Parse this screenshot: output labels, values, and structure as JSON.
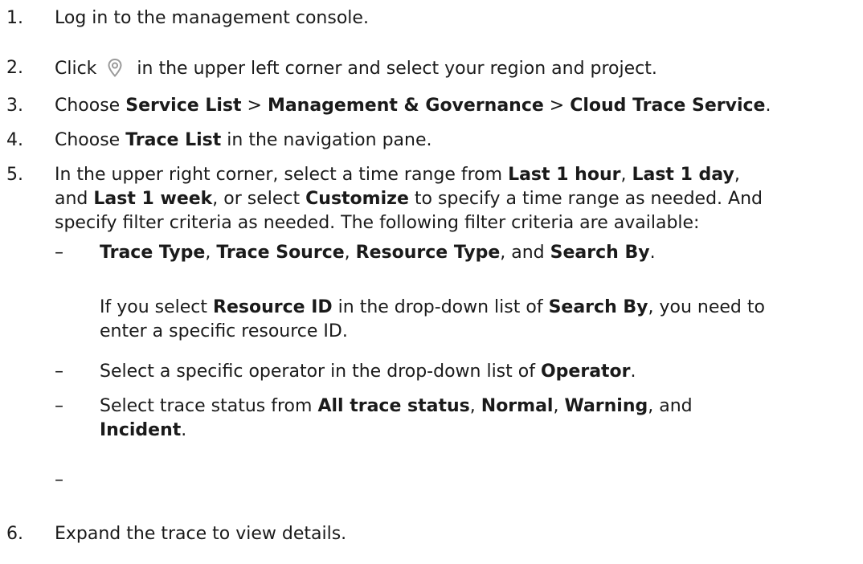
{
  "steps": [
    {
      "num": "1.",
      "text": "Log in to the management console."
    },
    {
      "num": "2.",
      "pre": "Click",
      "icon": "location-pin-icon",
      "post": "in the upper left corner and select your region and project."
    },
    {
      "num": "3.",
      "t0": "Choose ",
      "b1": "Service List",
      "t1": " > ",
      "b2": "Management & Governance",
      "t2": " > ",
      "b3": "Cloud Trace Service",
      "t3": "."
    },
    {
      "num": "4.",
      "t0": "Choose ",
      "b1": "Trace List",
      "t1": " in the navigation pane."
    },
    {
      "num": "5.",
      "t0": "In the upper right corner, select a time range from ",
      "b1": "Last 1 hour",
      "t1": ", ",
      "b2": "Last 1 day",
      "t2": ",",
      "t3": "and ",
      "b3": "Last 1 week",
      "t4": ", or select ",
      "b4": "Customize",
      "t5": " to specify a time range as needed. And",
      "t6": "specify filter criteria as needed. The following filter criteria are available:"
    },
    {
      "num": "6.",
      "text": "Expand the trace to view details."
    }
  ],
  "sub_items": [
    {
      "dash": "–",
      "b1": "Trace Type",
      "t1": ", ",
      "b2": "Trace Source",
      "t2": ", ",
      "b3": "Resource Type",
      "t3": ", and ",
      "b4": "Search By",
      "t4": "."
    },
    {
      "p0": "If you select ",
      "pb1": "Resource ID",
      "p1": " in the drop-down list of ",
      "pb2": "Search By",
      "p2": ", you need to",
      "p3": "enter a specific resource ID."
    },
    {
      "dash": "–",
      "t0": "Select a specific operator in the drop-down list of ",
      "b1": "Operator",
      "t1": "."
    },
    {
      "dash": "–",
      "t0": "Select trace status from ",
      "b1": "All trace status",
      "t1": ", ",
      "b2": "Normal",
      "t2": ", ",
      "b3": "Warning",
      "t3": ", and",
      "b4": "Incident",
      "t4": "."
    },
    {
      "dash": "–"
    }
  ],
  "colors": {
    "text": "#1a1a1a",
    "icon": "#9a9a9a"
  }
}
